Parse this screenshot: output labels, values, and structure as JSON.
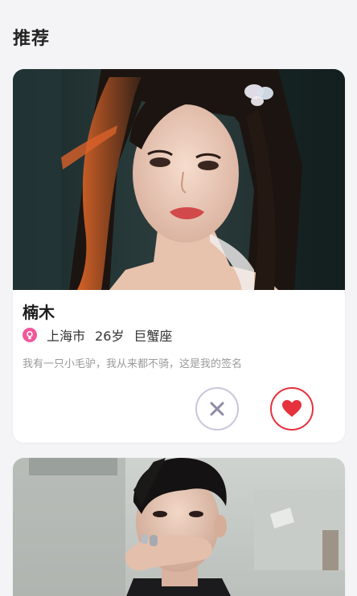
{
  "header": {
    "title": "推荐"
  },
  "profiles": [
    {
      "name": "楠木",
      "city": "上海市",
      "age": "26岁",
      "zodiac": "巨蟹座",
      "signature": "我有一只小毛驴，我从来都不骑，这是我的签名",
      "gender_icon": "female-icon"
    }
  ],
  "colors": {
    "background": "#f4f4f6",
    "gender_pink": "#f0589a",
    "like_red": "#e5323c",
    "dislike_gray": "#8f8ba8"
  },
  "icons": {
    "dislike": "close-icon",
    "like": "heart-icon"
  }
}
